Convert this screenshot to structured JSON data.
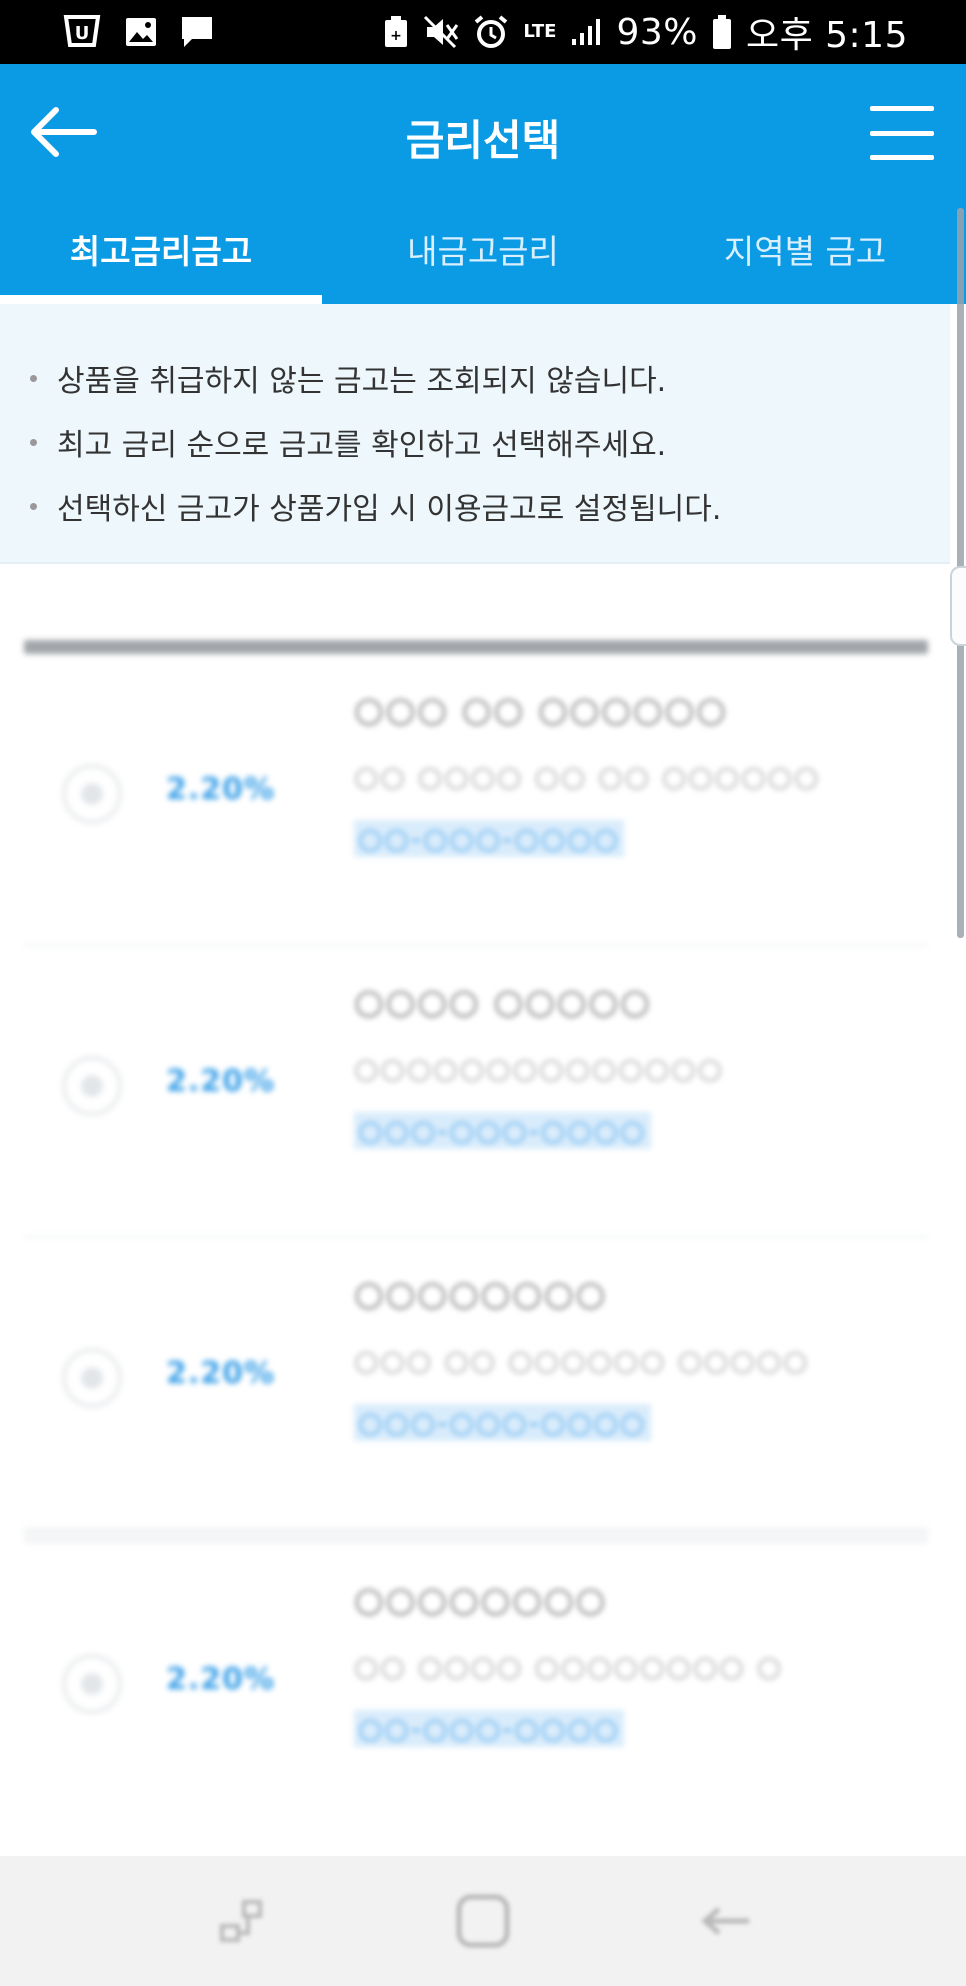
{
  "status_bar": {
    "battery": "93%",
    "time": "오후 5:15",
    "network": "LTE"
  },
  "header": {
    "title": "금리선택",
    "back_icon": "arrow-left-icon",
    "menu_icon": "hamburger-menu-icon"
  },
  "tabs": [
    {
      "label": "최고금리금고",
      "active": true
    },
    {
      "label": "내금고금리",
      "active": false
    },
    {
      "label": "지역별 금고",
      "active": false
    }
  ],
  "notice": {
    "items": [
      "상품을 취급하지 않는 금고는 조회되지 않습니다.",
      "최고 금리 순으로 금고를 확인하고 선택해주세요.",
      "선택하신 금고가 상품가입 시 이용금고로 설정됩니다."
    ]
  },
  "list": {
    "items": [
      {
        "rate": "2.20%",
        "name": "○○○ ○○ ○○○○○○",
        "address": "○○ ○○○○ ○○ ○○ ○○○○○○",
        "phone": "○○-○○○-○○○○"
      },
      {
        "rate": "2.20%",
        "name": "○○○○ ○○○○○",
        "address": "○○○○○○○○○○○○○○",
        "phone": "○○○-○○○-○○○○"
      },
      {
        "rate": "2.20%",
        "name": "○○○○○○○○",
        "address": "○○○ ○○ ○○○○○○ ○○○○○",
        "phone": "○○○-○○○-○○○○"
      },
      {
        "rate": "2.20%",
        "name": "○○○○○○○○",
        "address": "○○ ○○○○ ○○○○○○○○ ○",
        "phone": "○○-○○○-○○○○"
      }
    ]
  },
  "colors": {
    "primary": "#0a9be4",
    "notice_bg": "#eef7fc",
    "rate": "#3aa0e8"
  }
}
